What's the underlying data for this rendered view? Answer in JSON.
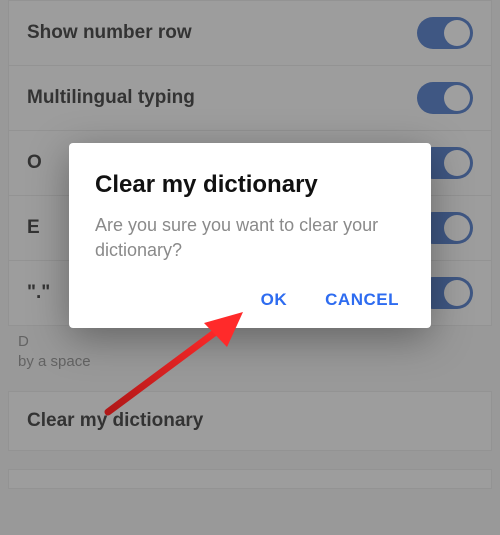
{
  "settings": {
    "rows": [
      {
        "label": "Show number row",
        "toggle": true
      },
      {
        "label": "Multilingual typing",
        "toggle": true
      },
      {
        "label": "O",
        "toggle": true
      },
      {
        "label": "E",
        "toggle": true
      },
      {
        "label": "\".\"",
        "toggle": true
      }
    ],
    "hint_line1": "D",
    "hint_line2": "by a space",
    "clear_label": "Clear my dictionary"
  },
  "dialog": {
    "title": "Clear my dictionary",
    "message": "Are you sure you want to clear your dictionary?",
    "ok": "OK",
    "cancel": "CANCEL"
  }
}
